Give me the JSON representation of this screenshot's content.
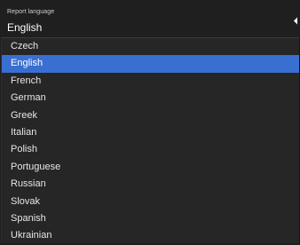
{
  "header": {
    "label": "Report language",
    "value": "English",
    "icon": "chevron-left-icon"
  },
  "options": [
    {
      "label": "Czech",
      "selected": false
    },
    {
      "label": "English",
      "selected": true
    },
    {
      "label": "French",
      "selected": false
    },
    {
      "label": "German",
      "selected": false
    },
    {
      "label": "Greek",
      "selected": false
    },
    {
      "label": "Italian",
      "selected": false
    },
    {
      "label": "Polish",
      "selected": false
    },
    {
      "label": "Portuguese",
      "selected": false
    },
    {
      "label": "Russian",
      "selected": false
    },
    {
      "label": "Slovak",
      "selected": false
    },
    {
      "label": "Spanish",
      "selected": false
    },
    {
      "label": "Ukrainian",
      "selected": false
    }
  ],
  "colors": {
    "selection": "#3a6fd2",
    "background": "#202020"
  }
}
